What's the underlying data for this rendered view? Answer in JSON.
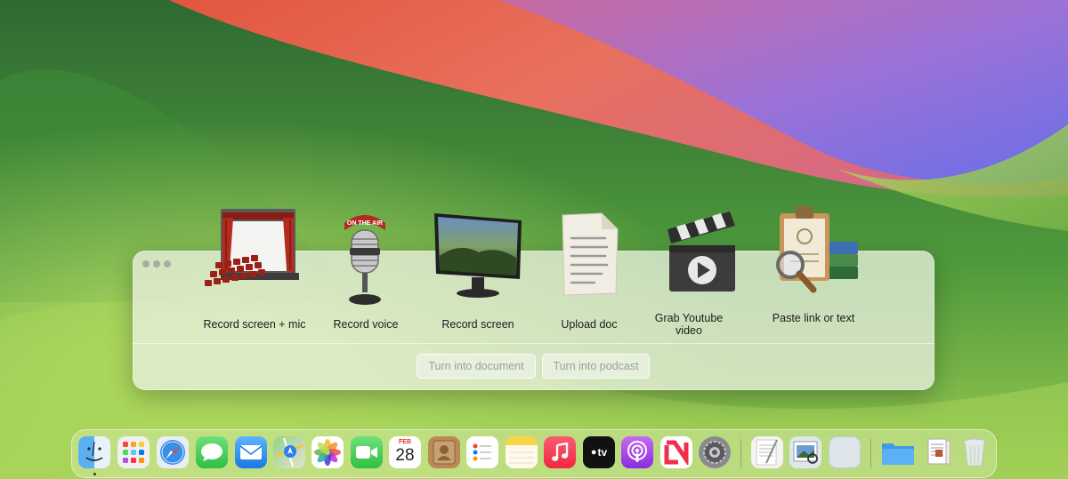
{
  "actions": [
    {
      "label": "Record screen + mic",
      "icon": "movie-theater-icon"
    },
    {
      "label": "Record voice",
      "icon": "microphone-on-air-icon",
      "sign": "ON THE AIR"
    },
    {
      "label": "Record screen",
      "icon": "monitor-icon"
    },
    {
      "label": "Upload doc",
      "icon": "document-icon"
    },
    {
      "label": "Grab Youtube video",
      "icon": "clapperboard-icon"
    },
    {
      "label": "Paste link or text",
      "icon": "clipboard-magnifier-icon"
    }
  ],
  "buttons": {
    "document": "Turn into document",
    "podcast": "Turn into podcast"
  },
  "dock": {
    "items": [
      "finder-icon",
      "launchpad-icon",
      "safari-icon",
      "messages-icon",
      "mail-icon",
      "maps-icon",
      "photos-icon",
      "facetime-icon",
      "calendar-icon",
      "contacts-icon",
      "reminders-icon",
      "notes-icon",
      "music-icon",
      "apple-tv-icon",
      "podcasts-icon",
      "news-icon",
      "system-settings-icon",
      "textedit-icon",
      "preview-icon",
      "blank-app-icon",
      "folder-icon",
      "document-stack-icon",
      "trash-icon"
    ],
    "calendar_month": "FEB",
    "calendar_day": "28",
    "tv_label": "tv"
  }
}
